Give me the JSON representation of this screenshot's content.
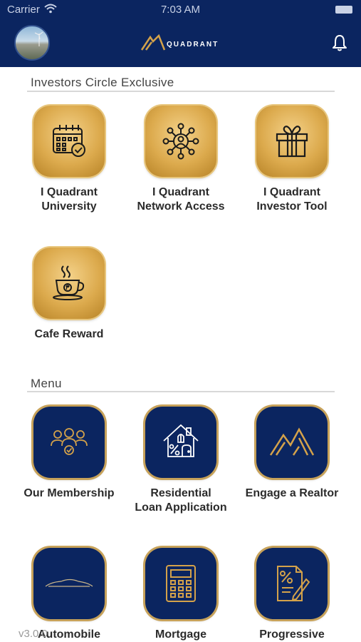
{
  "status": {
    "carrier": "Carrier",
    "time": "7:03 AM"
  },
  "header": {
    "brand": "QUADRANT"
  },
  "sections": {
    "exclusive_title": "Investors Circle Exclusive",
    "menu_title": "Menu"
  },
  "exclusive_items": [
    {
      "label": "I Quadrant\nUniversity",
      "icon": "calendar-check-icon"
    },
    {
      "label": "I Quadrant\nNetwork Access",
      "icon": "network-icon"
    },
    {
      "label": "I Quadrant\nInvestor Tool",
      "icon": "gift-icon"
    },
    {
      "label": "Cafe Reward",
      "icon": "coffee-cup-icon"
    }
  ],
  "menu_items": [
    {
      "label": "Our Membership",
      "icon": "membership-group-icon"
    },
    {
      "label": "Residential\nLoan Application",
      "icon": "house-percent-icon"
    },
    {
      "label": "Engage a Realtor",
      "icon": "mountain-logo-icon"
    },
    {
      "label": "Automobile",
      "icon": "car-icon"
    },
    {
      "label": "Mortgage",
      "icon": "calculator-icon"
    },
    {
      "label": "Progressive",
      "icon": "document-percent-icon"
    }
  ],
  "footer": {
    "version": "v3.0.0"
  },
  "colors": {
    "navy": "#0b2560",
    "gold": "#d4a24a"
  }
}
